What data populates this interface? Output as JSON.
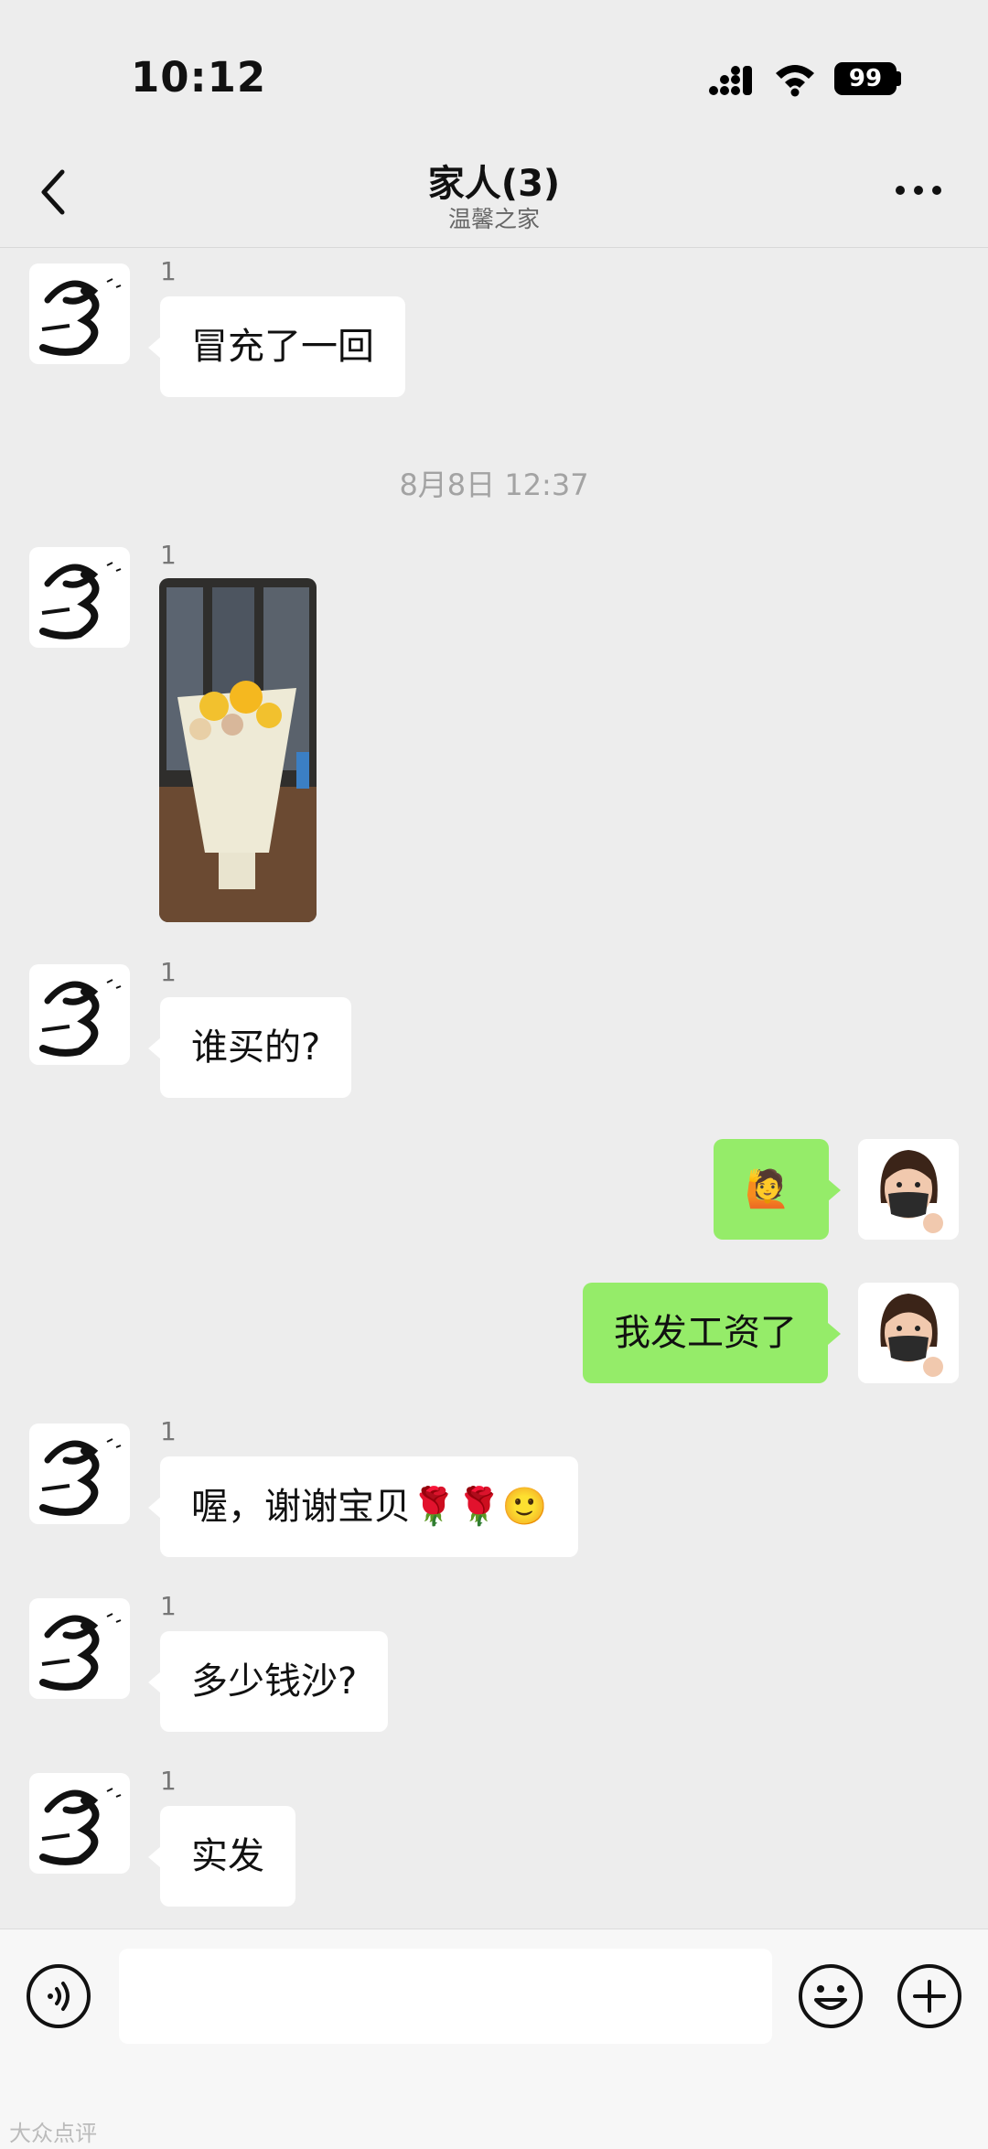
{
  "status_bar": {
    "time": "10:12",
    "battery": "99"
  },
  "header": {
    "title": "家人(3)",
    "subtitle": "温馨之家"
  },
  "messages": {
    "m1": {
      "nickname": "1",
      "text": "冒充了一回"
    },
    "timestamp": "8月8日 12:37",
    "m2": {
      "nickname": "1",
      "type": "image"
    },
    "m3": {
      "nickname": "1",
      "text": "谁买的?"
    },
    "m4": {
      "text": "🙋"
    },
    "m5": {
      "text": "我发工资了"
    },
    "m6": {
      "nickname": "1",
      "text": "喔，谢谢宝贝🌹🌹🙂"
    },
    "m7": {
      "nickname": "1",
      "text": "多少钱沙?"
    },
    "m8": {
      "nickname": "1",
      "text": "实发"
    }
  },
  "input": {
    "placeholder": ""
  },
  "watermark": "大众点评"
}
